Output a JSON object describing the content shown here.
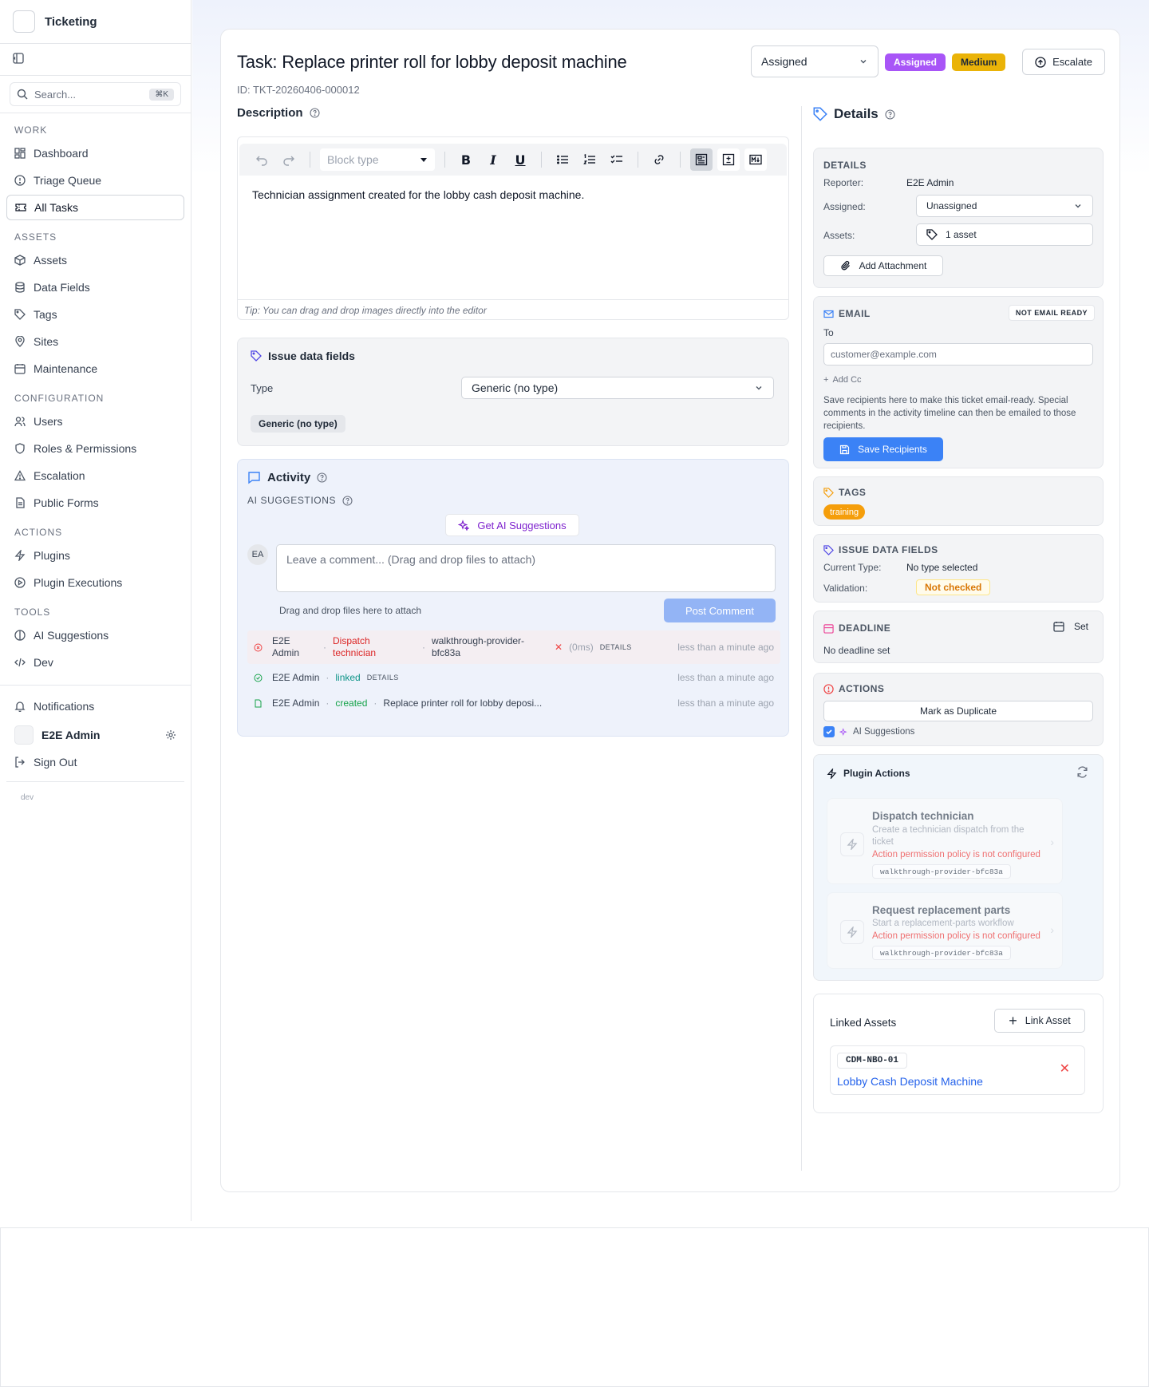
{
  "app": {
    "name": "Ticketing",
    "env": "dev"
  },
  "search": {
    "placeholder": "Search...",
    "shortcut": "⌘K"
  },
  "nav": {
    "sections": [
      {
        "heading": "WORK",
        "items": [
          "Dashboard",
          "Triage Queue",
          "All Tasks"
        ]
      },
      {
        "heading": "ASSETS",
        "items": [
          "Assets",
          "Data Fields",
          "Tags",
          "Sites",
          "Maintenance"
        ]
      },
      {
        "heading": "CONFIGURATION",
        "items": [
          "Users",
          "Roles & Permissions",
          "Escalation",
          "Public Forms"
        ]
      },
      {
        "heading": "ACTIONS",
        "items": [
          "Plugins",
          "Plugin Executions"
        ]
      },
      {
        "heading": "TOOLS",
        "items": [
          "AI Suggestions",
          "Dev"
        ]
      }
    ],
    "active": "All Tasks",
    "notifications": "Notifications",
    "user": "E2E Admin",
    "sign_out": "Sign Out"
  },
  "task": {
    "title": "Task: Replace printer roll for lobby deposit machine",
    "id": "ID: TKT-20260406-000012",
    "status_select": "Assigned",
    "status_badge": "Assigned",
    "priority_badge": "Medium",
    "escalate": "Escalate"
  },
  "description": {
    "label": "Description",
    "block_type_placeholder": "Block type",
    "body": "Technician assignment created for the lobby cash deposit machine.",
    "tip": "Tip: You can drag and drop images directly into the editor"
  },
  "issue_fields": {
    "title": "Issue data fields",
    "type_label": "Type",
    "type_value": "Generic (no type)",
    "chip": "Generic (no type)"
  },
  "activity": {
    "title": "Activity",
    "ai_label": "AI SUGGESTIONS",
    "ai_button": "Get AI Suggestions",
    "avatar": "EA",
    "comment_placeholder": "Leave a comment... (Drag and drop files to attach)",
    "drop_hint": "Drag and drop files here to attach",
    "post": "Post Comment",
    "entries": [
      {
        "user": "E2E Admin",
        "action": "Dispatch technician",
        "target": "walkthrough-provider-bfc83a",
        "status": "✕",
        "duration": "(0ms)",
        "details": "DETAILS",
        "time": "less than a minute ago"
      },
      {
        "user": "E2E Admin",
        "action": "linked",
        "details": "DETAILS",
        "time": "less than a minute ago"
      },
      {
        "user": "E2E Admin",
        "action": "created",
        "target": "Replace printer roll for lobby deposi...",
        "time": "less than a minute ago"
      }
    ]
  },
  "details": {
    "title": "Details",
    "heading": "DETAILS",
    "reporter_label": "Reporter:",
    "reporter": "E2E Admin",
    "assigned_label": "Assigned:",
    "assigned": "Unassigned",
    "assets_label": "Assets:",
    "assets": "1 asset",
    "add_attachment": "Add Attachment"
  },
  "email": {
    "heading": "EMAIL",
    "status": "NOT EMAIL READY",
    "to_label": "To",
    "to_placeholder": "customer@example.com",
    "add_cc": "Add Cc",
    "help": "Save recipients here to make this ticket email-ready. Special comments in the activity timeline can then be emailed to those recipients.",
    "save": "Save Recipients"
  },
  "tags": {
    "heading": "TAGS",
    "items": [
      "training"
    ]
  },
  "idf_panel": {
    "heading": "ISSUE DATA FIELDS",
    "current_type_label": "Current Type:",
    "current_type": "No type selected",
    "validation_label": "Validation:",
    "validation": "Not checked"
  },
  "deadline": {
    "heading": "DEADLINE",
    "set": "Set",
    "value": "No deadline set"
  },
  "actions": {
    "heading": "ACTIONS",
    "duplicate": "Mark as Duplicate",
    "ai_suggestions": "AI Suggestions",
    "ai_checked": true
  },
  "plugin_actions": {
    "heading": "Plugin Actions",
    "items": [
      {
        "name": "Dispatch technician",
        "desc": "Create a technician dispatch from the ticket",
        "warning": "Action permission policy is not configured",
        "provider": "walkthrough-provider-bfc83a"
      },
      {
        "name": "Request replacement parts",
        "desc": "Start a replacement-parts workflow",
        "warning": "Action permission policy is not configured",
        "provider": "walkthrough-provider-bfc83a"
      }
    ]
  },
  "linked_assets": {
    "heading": "Linked Assets",
    "link_button": "Link Asset",
    "items": [
      {
        "code": "CDM-NBO-01",
        "name": "Lobby Cash Deposit Machine"
      }
    ]
  },
  "colors": {
    "primary": "#3b82f6",
    "purple": "#a855f7",
    "amber": "#eab308",
    "orange": "#f59e0b",
    "danger": "#ef4444"
  }
}
